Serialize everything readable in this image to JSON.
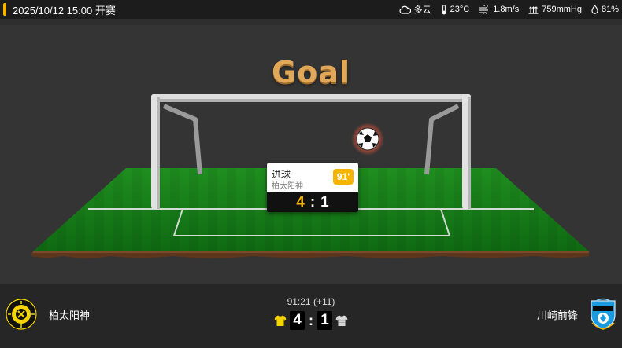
{
  "header": {
    "kickoff": "2025/10/12 15:00 开赛",
    "accent_color": "#f5b400"
  },
  "weather": {
    "condition": "多云",
    "condition_icon": "cloud-icon",
    "temperature": "23°C",
    "temperature_icon": "thermometer-icon",
    "wind": "1.8m/s",
    "wind_icon": "wind-icon",
    "pressure": "759mmHg",
    "pressure_icon": "pressure-icon",
    "humidity": "81%",
    "humidity_icon": "droplet-icon"
  },
  "animation": {
    "title": "Goal",
    "ball_icon": "soccer-ball-icon"
  },
  "event": {
    "title": "进球",
    "team": "柏太阳神",
    "minute": "91'",
    "score_home": "4",
    "score_sep": ":",
    "score_away": "1"
  },
  "match": {
    "home_team": "柏太阳神",
    "away_team": "川崎前锋",
    "home_logo_icon": "kashiwa-reysol-crest-icon",
    "away_logo_icon": "kawasaki-frontale-crest-icon",
    "clock": "91:21 (+11)",
    "home_score": "4",
    "away_score": "1",
    "score_sep": ":",
    "home_kit_color": "#f5d400",
    "away_kit_color": "#d8d8d8"
  }
}
